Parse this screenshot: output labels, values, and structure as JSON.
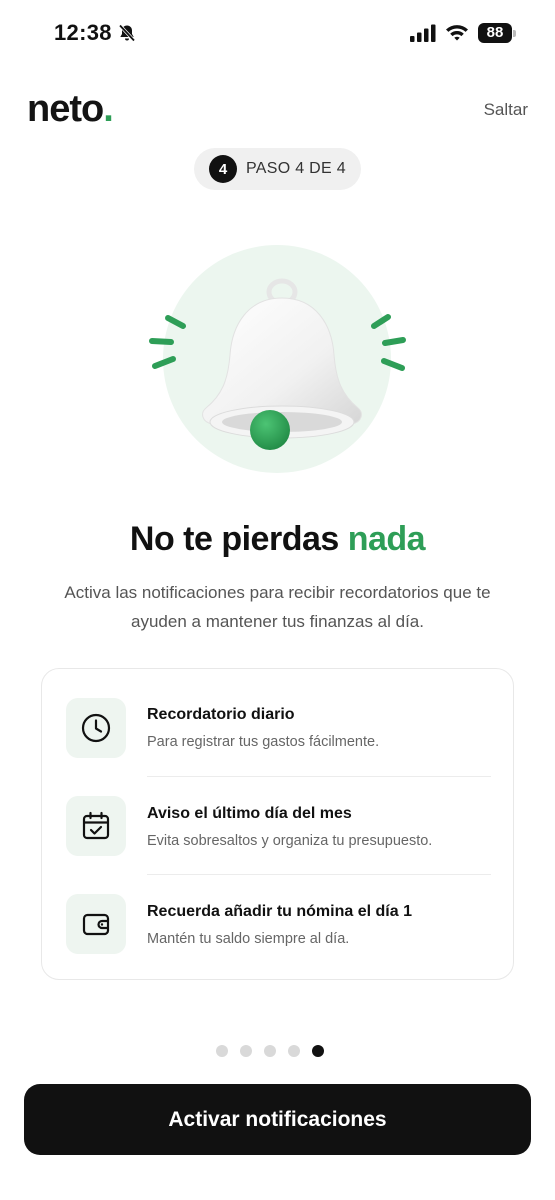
{
  "status_bar": {
    "time": "12:38",
    "battery": "88",
    "icons": [
      "bell-slash-icon",
      "signal-icon",
      "wifi-icon",
      "battery-icon"
    ]
  },
  "header": {
    "logo_text": "neto",
    "logo_dot": ".",
    "skip_label": "Saltar"
  },
  "step": {
    "number": "4",
    "label": "PASO 4 DE 4"
  },
  "hero": {
    "illustration": "bell-icon",
    "title_main": "No te pierdas ",
    "title_accent": "nada",
    "subtitle": "Activa las notificaciones para recibir recordatorios que te ayuden a mantener tus finanzas al día."
  },
  "features": [
    {
      "icon": "clock-icon",
      "title": "Recordatorio diario",
      "description": "Para registrar tus gastos fácilmente."
    },
    {
      "icon": "calendar-check-icon",
      "title": "Aviso el último día del mes",
      "description": "Evita sobresaltos y organiza tu presupuesto."
    },
    {
      "icon": "wallet-icon",
      "title": "Recuerda añadir tu nómina el día 1",
      "description": "Mantén tu saldo siempre al día."
    }
  ],
  "pagination": {
    "total": 5,
    "current": 5
  },
  "cta": {
    "label": "Activar notificaciones"
  },
  "colors": {
    "accent": "#2e9e57",
    "dark": "#111111",
    "hero_bg": "#ecf6ef",
    "icon_bg": "#eef5f0"
  }
}
